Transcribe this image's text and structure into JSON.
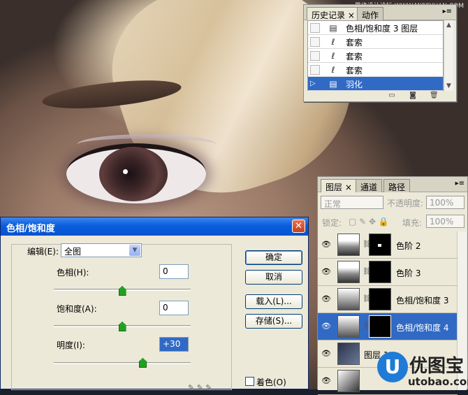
{
  "watermark_top": "思缘设计论坛  WWW.MISSYUAN.COM",
  "history_panel": {
    "tabs": [
      "历史记录 ×",
      "动作"
    ],
    "items": [
      {
        "label": "色相/饱和度 3 图层",
        "icon": "layer-adjust-icon"
      },
      {
        "label": "套索",
        "icon": "lasso-icon"
      },
      {
        "label": "套索",
        "icon": "lasso-icon"
      },
      {
        "label": "套索",
        "icon": "lasso-icon"
      },
      {
        "label": "羽化",
        "icon": "feather-icon",
        "selected": true
      }
    ]
  },
  "layers_panel": {
    "tabs": [
      "图层 ×",
      "通道",
      "路径"
    ],
    "blend_mode": "正常",
    "opacity_label": "不透明度:",
    "opacity_value": "100%",
    "lock_label": "锁定:",
    "fill_label": "填充:",
    "fill_value": "100%",
    "layers": [
      {
        "name": "色阶 2"
      },
      {
        "name": "色阶 3"
      },
      {
        "name": "色相/饱和度 3"
      },
      {
        "name": "色相/饱和度 4",
        "selected": true
      },
      {
        "name": "图层 1"
      },
      {
        "name": ""
      }
    ]
  },
  "dialog": {
    "title": "色相/饱和度",
    "edit_label": "编辑(E):",
    "edit_value": "全图",
    "hue_label": "色相(H):",
    "hue_value": "0",
    "hue_slider_pct": 50,
    "saturation_label": "饱和度(A):",
    "saturation_value": "0",
    "saturation_slider_pct": 50,
    "lightness_label": "明度(I):",
    "lightness_value": "+30",
    "lightness_slider_pct": 65,
    "ok_label": "确定",
    "cancel_label": "取消",
    "load_label": "载入(L)...",
    "save_label": "存储(S)...",
    "colorize_label": "着色(O)"
  },
  "watermark": {
    "name": "优图宝",
    "url": "utobao.com"
  }
}
